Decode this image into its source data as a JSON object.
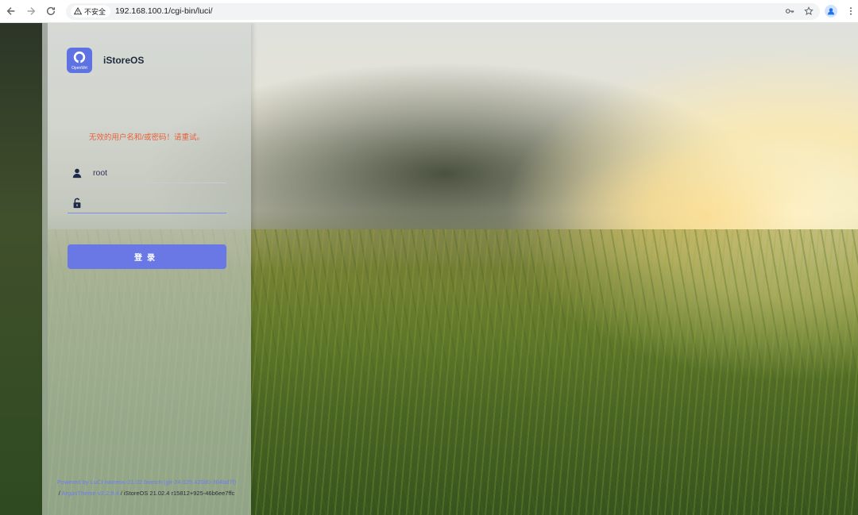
{
  "browser": {
    "security_label": "不安全",
    "url": "192.168.100.1/cgi-bin/luci/"
  },
  "brand": {
    "name": "iStoreOS",
    "logo_text": "OpenWrt",
    "logo_color": "#5e72e4"
  },
  "login": {
    "error_message": "无效的用户名和/或密码！请重试。",
    "username_value": "root",
    "password_value": "",
    "submit_label": "登录",
    "accent_color": "#6a78e6"
  },
  "footer": {
    "line1": "Powered by LuCI istoreos-21.02 branch (git-24.025.42080-304bd7f)",
    "line2_prefix": "/ ",
    "theme_link": "ArgonTheme v2.2.9.4",
    "line2_suffix": " / iStoreOS 21.02.4 r15812+925-46b6ee7ffc"
  },
  "icons": {
    "back": "arrow-left-icon",
    "forward": "arrow-right-icon",
    "reload": "reload-icon",
    "warning": "warning-icon",
    "key": "key-icon",
    "star": "star-icon",
    "profile": "profile-icon",
    "menu": "more-vert-icon",
    "user": "user-icon",
    "lock": "lock-icon"
  }
}
